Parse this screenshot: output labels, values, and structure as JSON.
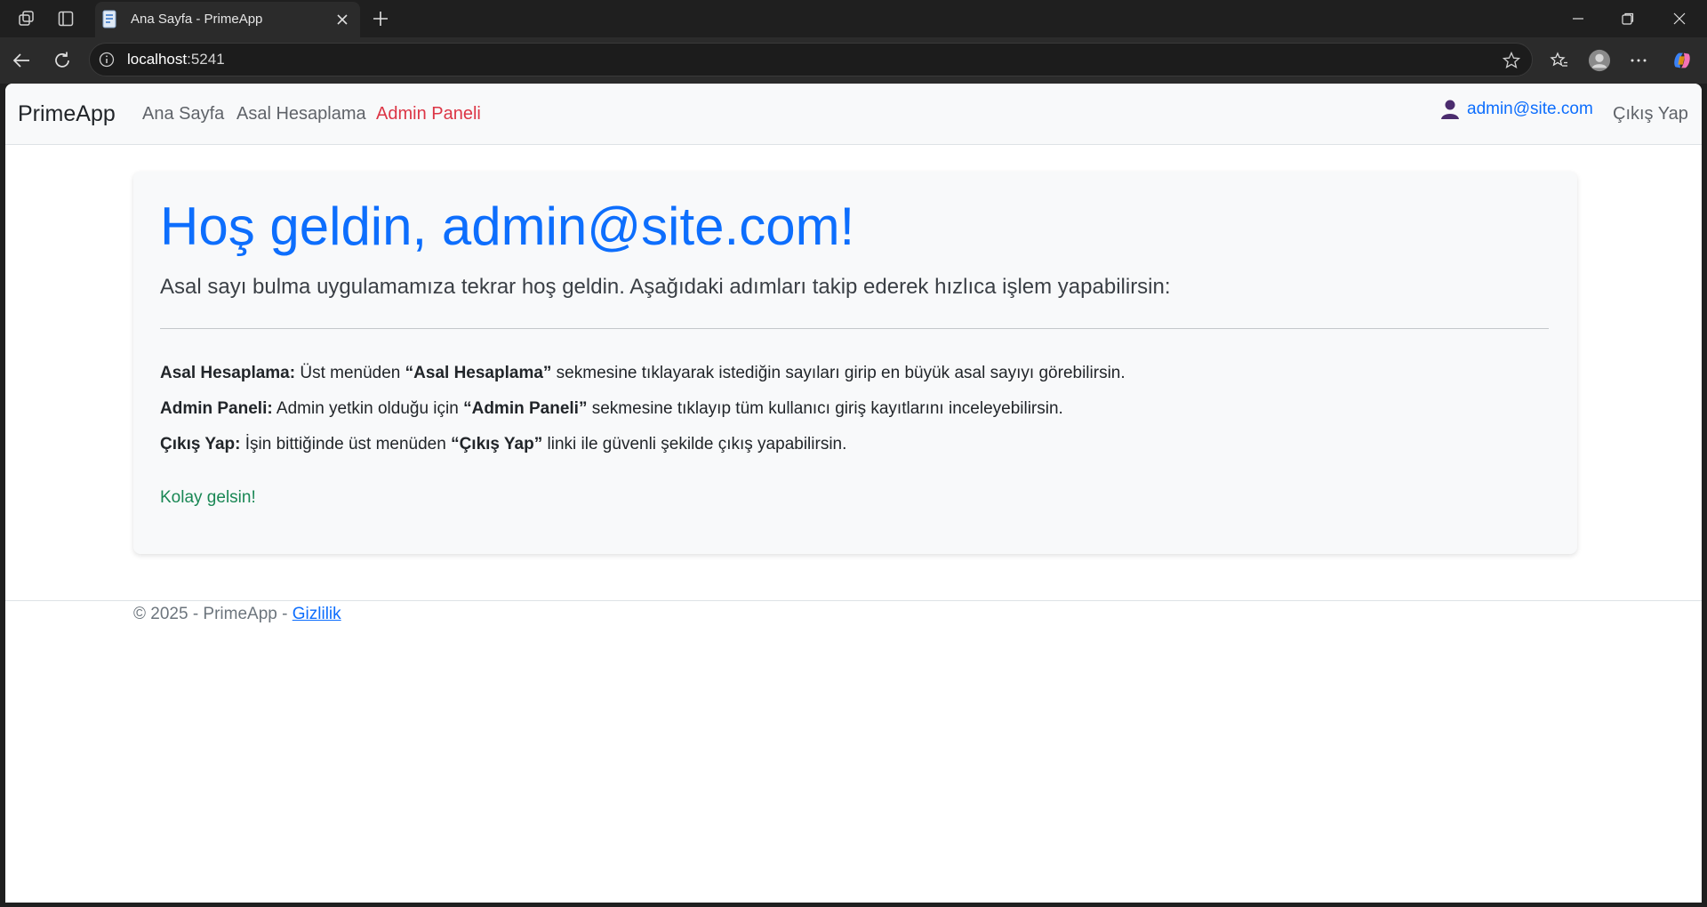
{
  "browser": {
    "tab_title": "Ana Sayfa - PrimeApp",
    "url_host": "localhost",
    "url_port": ":5241"
  },
  "navbar": {
    "brand": "PrimeApp",
    "links": [
      "Ana Sayfa",
      "Asal Hesaplama",
      "Admin Paneli"
    ],
    "user_email": "admin@site.com",
    "logout": "Çıkış Yap"
  },
  "main": {
    "welcome": "Hoş geldin, admin@site.com!",
    "lead": "Asal sayı bulma uygulamamıza tekrar hoş geldin. Aşağıdaki adımları takip ederek hızlıca işlem yapabilirsin:",
    "steps": [
      {
        "label": "Asal Hesaplama:",
        "text_before": " Üst menüden ",
        "emph": "“Asal Hesaplama”",
        "text_after": " sekmesine tıklayarak istediğin sayıları girip en büyük asal sayıyı görebilirsin."
      },
      {
        "label": "Admin Paneli:",
        "text_before": " Admin yetkin olduğu için ",
        "emph": "“Admin Paneli”",
        "text_after": " sekmesine tıklayıp tüm kullanıcı giriş kayıtlarını inceleyebilirsin."
      },
      {
        "label": "Çıkış Yap:",
        "text_before": " İşin bittiğinde üst menüden ",
        "emph": "“Çıkış Yap”",
        "text_after": " linki ile güvenli şekilde çıkış yapabilirsin."
      }
    ],
    "closing": "Kolay gelsin!"
  },
  "footer": {
    "copyright": "© 2025 - PrimeApp - ",
    "privacy_link": "Gizlilik"
  },
  "colors": {
    "primary": "#0d6efd",
    "danger": "#dc3545",
    "success": "#198754"
  }
}
